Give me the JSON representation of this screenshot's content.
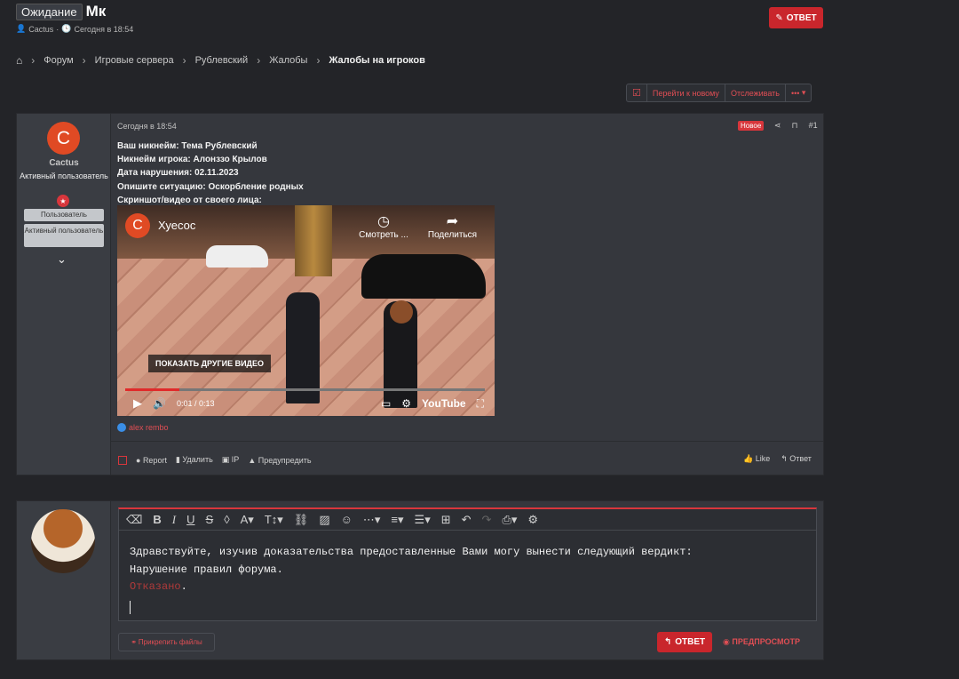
{
  "thread": {
    "status_chip": "Ожидание",
    "title": "Мк",
    "author": "Cactus",
    "time": "Сегодня в 18:54",
    "reply_button": "ОТВЕТ"
  },
  "breadcrumbs": [
    "Форум",
    "Игровые сервера",
    "Рублевский",
    "Жалобы",
    "Жалобы на игроков"
  ],
  "thread_tools": {
    "goto_new": "Перейти к новому",
    "watch": "Отслеживать",
    "more": "•••"
  },
  "post": {
    "user": {
      "avatar_letter": "C",
      "name": "Cactus",
      "title": "Активный пользователь",
      "tags": [
        "Пользователь",
        "Активный пользователь"
      ]
    },
    "date": "Сегодня в 18:54",
    "new_badge": "Новое",
    "number": "#1",
    "lines": [
      "Ваш никнейм: Тема Рублевский",
      "Никнейм игрока: Алонззо Крылов",
      "Дата нарушения: 02.11.2023",
      "Опишите ситуацию: Оскорбление родных",
      "Скриншот/видео от своего лица:"
    ],
    "video": {
      "channel_letter": "C",
      "channel_name": "Хуесос",
      "watch_label": "Смотреть ...",
      "share_label": "Поделиться",
      "more_videos": "ПОКАЗАТЬ ДРУГИЕ ВИДЕО",
      "time": "0:01 / 0:13",
      "brand": "YouTube",
      "progress": 0.15
    },
    "reactor": "alex rembo",
    "footer": {
      "report": "Report",
      "delete": "Удалить",
      "ip": "IP",
      "warn": "Предупредить",
      "like": "Like",
      "reply": "Ответ"
    }
  },
  "editor": {
    "line1": "Здравствуйте, изучив доказательства предоставленные Вами могу вынести следующий вердикт:",
    "line2": "Нарушение правил форума.",
    "line3_red": "Отказано",
    "line3_tail": ".",
    "attach": "Прикрепить файлы",
    "send": "ОТВЕТ",
    "preview": "ПРЕДПРОСМОТР"
  }
}
